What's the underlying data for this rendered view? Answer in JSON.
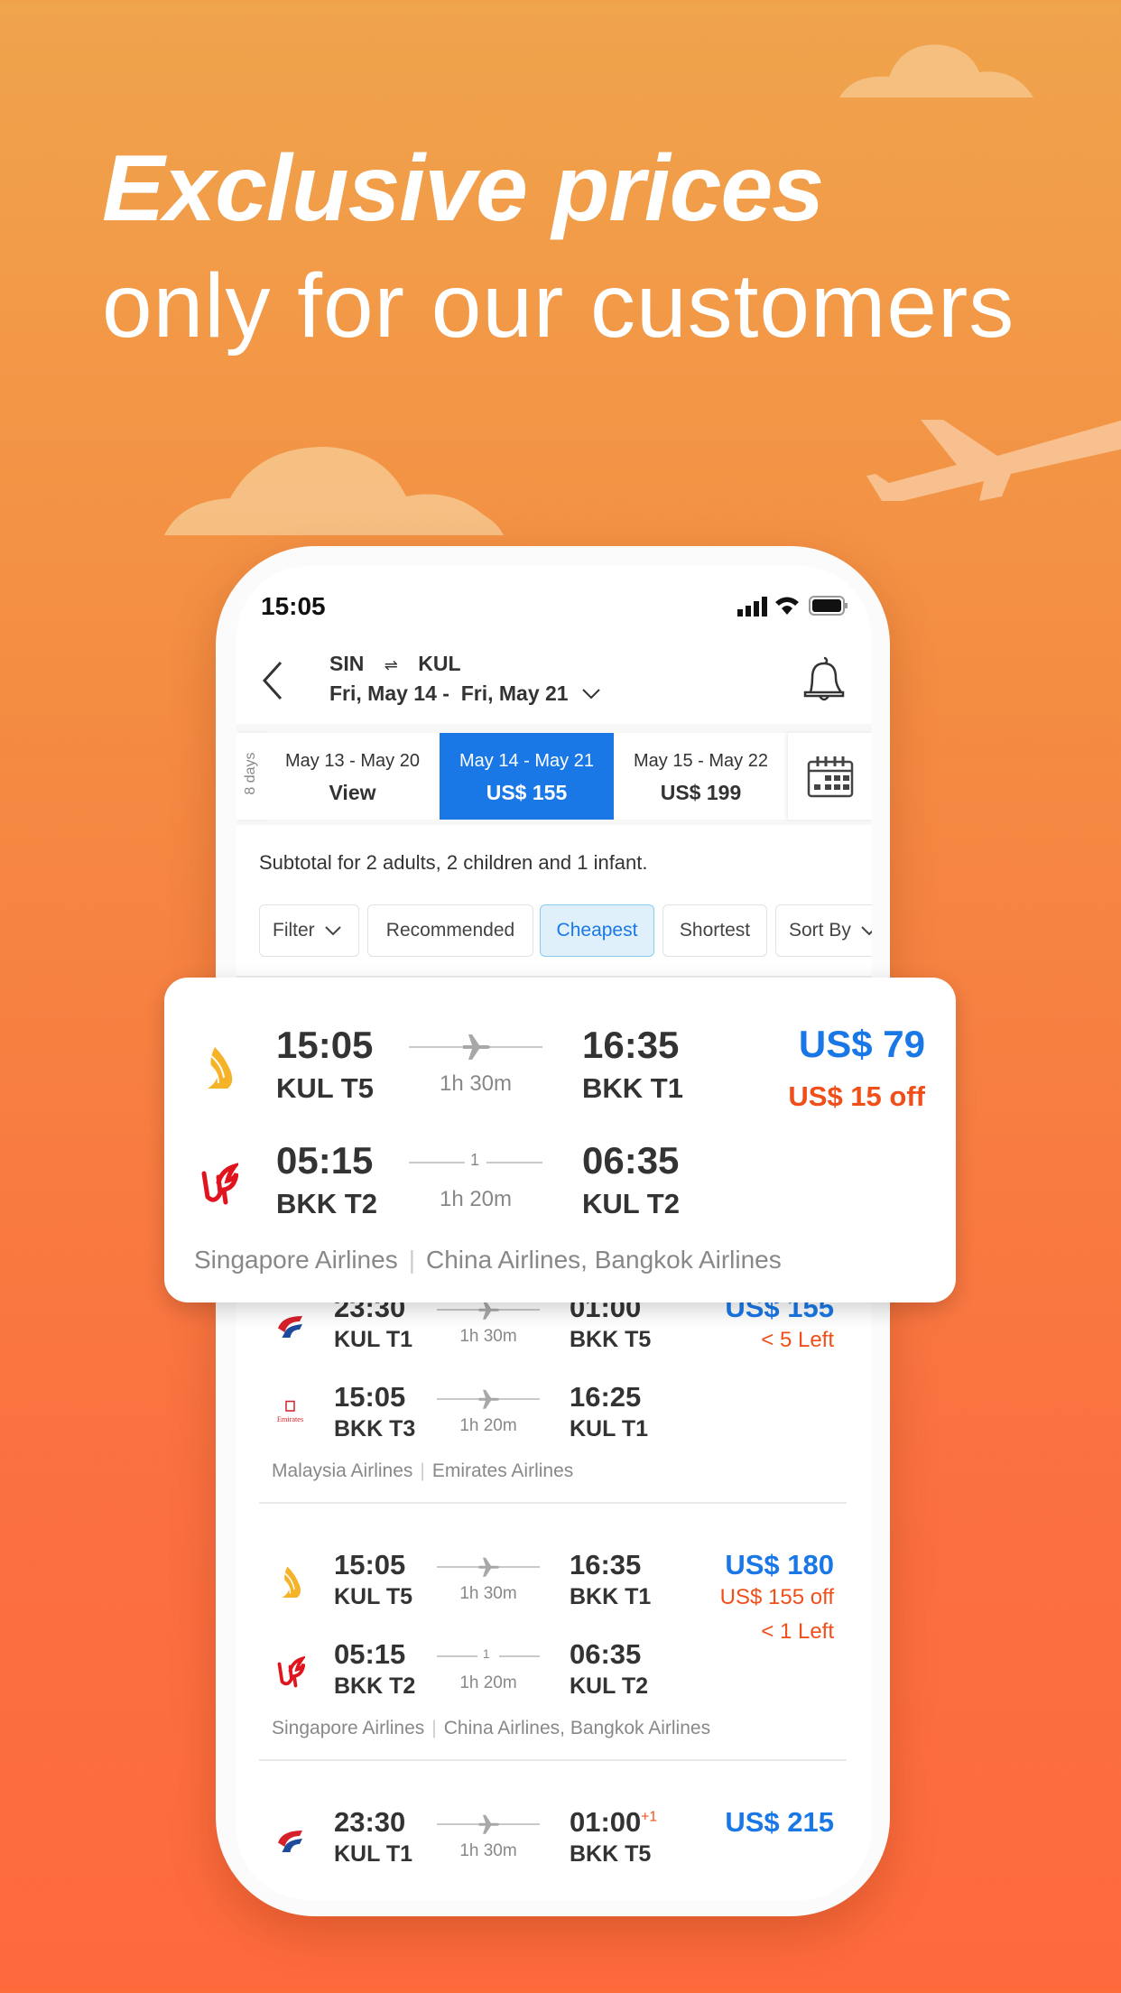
{
  "promo": {
    "headline": "Exclusive prices",
    "subheadline": "only for our customers"
  },
  "status_bar": {
    "time": "15:05"
  },
  "header": {
    "origin": "SIN",
    "swap_icon": "⇌",
    "destination": "KUL",
    "dates": "Fri, May 14 -  Fri, May 21"
  },
  "date_tabs": {
    "duration_label": "8 days",
    "tabs": [
      {
        "dates": "May 13 - May 20",
        "price": "View",
        "selected": false
      },
      {
        "dates": "May 14 - May 21",
        "price": "US$ 155",
        "selected": true
      },
      {
        "dates": "May 15 - May 22",
        "price": "US$ 199",
        "selected": false
      }
    ]
  },
  "subtotal": "Subtotal for 2 adults, 2 children and 1 infant.",
  "chips": [
    {
      "label": "Filter",
      "has_chevron": true
    },
    {
      "label": "Recommended"
    },
    {
      "label": "Cheapest",
      "active": true
    },
    {
      "label": "Shortest"
    },
    {
      "label": "Sort By",
      "has_chevron": true
    }
  ],
  "featured": {
    "price": "US$ 79",
    "discount": "US$ 15 off",
    "legs": [
      {
        "logo": "singapore-airlines",
        "dep_time": "15:05",
        "dep_airport": "KUL T5",
        "duration": "1h 30m",
        "stops": "",
        "arr_time": "16:35",
        "arr_airport": "BKK T1"
      },
      {
        "logo": "china-airlines",
        "dep_time": "05:15",
        "dep_airport": "BKK T2",
        "duration": "1h 20m",
        "stops": "1",
        "arr_time": "06:35",
        "arr_airport": "KUL T2"
      }
    ],
    "airlines_out": "Singapore Airlines",
    "airlines_ret": "China Airlines, Bangkok Airlines"
  },
  "flights": [
    {
      "price": "US$ 155",
      "discount": "",
      "seats": "< 5 Left",
      "legs": [
        {
          "logo": "malaysia-airlines",
          "dep_time": "23:30",
          "dep_airport": "KUL T1",
          "duration": "1h 30m",
          "stops": "",
          "arr_time": "01:00",
          "arr_airport": "BKK T5"
        },
        {
          "logo": "emirates",
          "dep_time": "15:05",
          "dep_airport": "BKK T3",
          "duration": "1h 20m",
          "stops": "",
          "arr_time": "16:25",
          "arr_airport": "KUL T1"
        }
      ],
      "airlines_out": "Malaysia Airlines",
      "airlines_ret": "Emirates Airlines"
    },
    {
      "price": "US$ 180",
      "discount": "US$ 155 off",
      "seats": "< 1 Left",
      "legs": [
        {
          "logo": "singapore-airlines",
          "dep_time": "15:05",
          "dep_airport": "KUL T5",
          "duration": "1h 30m",
          "stops": "",
          "arr_time": "16:35",
          "arr_airport": "BKK T1"
        },
        {
          "logo": "china-airlines",
          "dep_time": "05:15",
          "dep_airport": "BKK T2",
          "duration": "1h 20m",
          "stops": "1",
          "arr_time": "06:35",
          "arr_airport": "KUL T2"
        }
      ],
      "airlines_out": "Singapore Airlines",
      "airlines_ret": "China Airlines, Bangkok Airlines"
    },
    {
      "price": "US$ 215",
      "discount": "",
      "seats": "",
      "legs": [
        {
          "logo": "malaysia-airlines",
          "dep_time": "23:30",
          "dep_airport": "KUL T1",
          "duration": "1h 30m",
          "stops": "",
          "arr_time": "01:00",
          "arr_day_offset": "+1",
          "arr_airport": "BKK T5"
        }
      ],
      "airlines_out": "",
      "airlines_ret": ""
    }
  ],
  "colors": {
    "accent": "#1a78e6",
    "discount": "#f04f1a",
    "bg_top": "#f0a44c",
    "bg_bottom": "#fe6a3c"
  }
}
